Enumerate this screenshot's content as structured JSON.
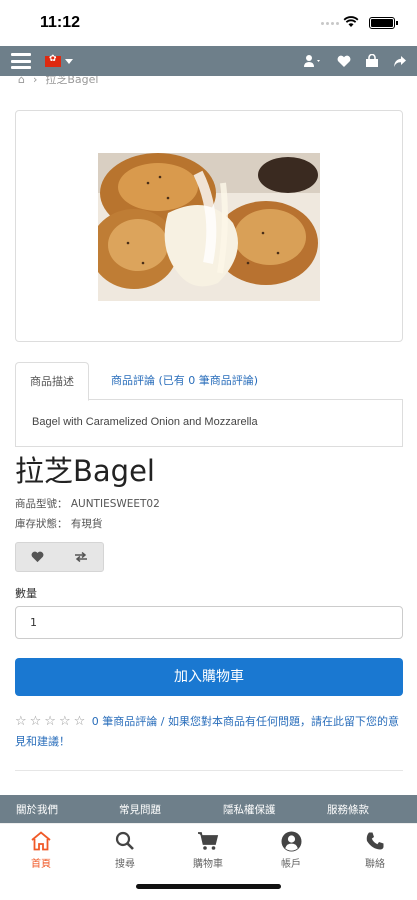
{
  "status_bar": {
    "time": "11:12"
  },
  "nav": {
    "menu_icon": "hamburger-icon",
    "flag_icon": "hong-kong-flag-icon",
    "right_icons": [
      "user-icon",
      "heart-icon",
      "shopping-bag-icon",
      "share-icon"
    ]
  },
  "breadcrumb": {
    "home_icon": "home-icon",
    "current": "拉芝Bagel"
  },
  "product": {
    "image_alt": "bagel-photo",
    "title": "拉芝Bagel",
    "model_line": "商品型號： AUNTIESWEET02",
    "stock_line": "庫存狀態： 有現貨"
  },
  "tabs": {
    "description_label": "商品描述",
    "reviews_label": "商品評論 (已有 0 筆商品評論)",
    "description_text": "Bagel with Caramelized Onion and Mozzarella"
  },
  "actions": {
    "wishlist_icon": "heart-icon",
    "compare_icon": "exchange-icon",
    "quantity_label": "數量",
    "quantity_value": "1",
    "add_to_cart": "加入購物車"
  },
  "reviews": {
    "rating": 0,
    "max_rating": 5,
    "text": "0 筆商品評論 / 如果您對本商品有任何問題，請在此留下您的意見和建議！"
  },
  "footer_links": [
    "關於我們",
    "常見問題",
    "隱私權保護",
    "服務條款"
  ],
  "tabbar": [
    {
      "label": "首頁",
      "icon": "home-icon",
      "active": true
    },
    {
      "label": "搜尋",
      "icon": "search-icon",
      "active": false
    },
    {
      "label": "購物車",
      "icon": "cart-icon",
      "active": false
    },
    {
      "label": "帳戶",
      "icon": "account-icon",
      "active": false
    },
    {
      "label": "聯絡",
      "icon": "phone-icon",
      "active": false
    }
  ],
  "colors": {
    "nav_bg": "#6e7f8a",
    "primary_button": "#1a78d1",
    "link": "#2a6ebb",
    "active_tab": "#f05a28"
  }
}
